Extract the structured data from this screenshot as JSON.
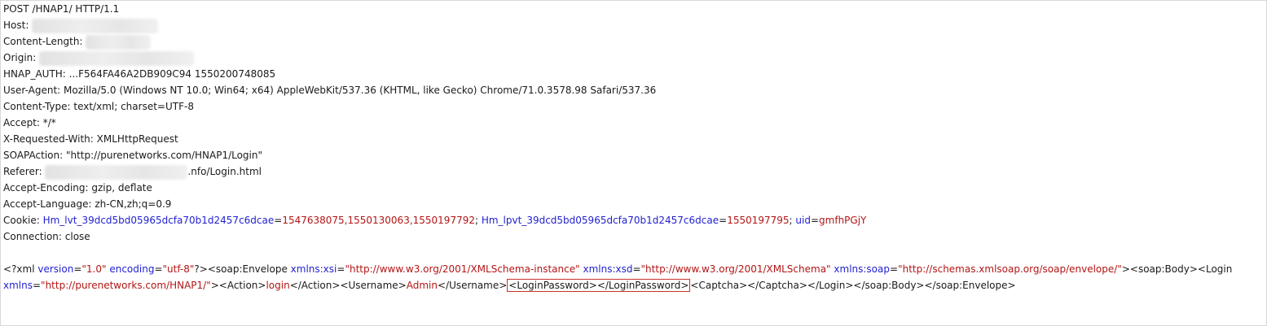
{
  "request_line": "POST /HNAP1/ HTTP/1.1",
  "headers": [
    {
      "key": "Host:",
      "value": ""
    },
    {
      "key": "Content-Length: ",
      "value": ""
    },
    {
      "key": "Origin: ",
      "value": ""
    },
    {
      "key": "HNAP_AUTH: ",
      "value": "...F564FA46A2DB909C94 1550200748085"
    },
    {
      "key": "User-Agent: ",
      "value": "Mozilla/5.0 (Windows NT 10.0; Win64; x64) AppleWebKit/537.36 (KHTML, like Gecko) Chrome/71.0.3578.98 Safari/537.36"
    },
    {
      "key": "Content-Type: ",
      "value": "text/xml; charset=UTF-8"
    },
    {
      "key": "Accept: ",
      "value": "*/*"
    },
    {
      "key": "X-Requested-With: ",
      "value": "XMLHttpRequest"
    },
    {
      "key": "SOAPAction: ",
      "value": "\"http://purenetworks.com/HNAP1/Login\""
    },
    {
      "key": "Referer: ",
      "value": ".nfo/Login.html"
    },
    {
      "key": "Accept-Encoding: ",
      "value": "gzip, deflate"
    },
    {
      "key": "Accept-Language: ",
      "value": "zh-CN,zh;q=0.9"
    }
  ],
  "cookie": {
    "label": "Cookie: ",
    "pairs": [
      {
        "name": "Hm_lvt_39dcd5bd05965dcfa70b1d2457c6dcae",
        "eq": "=",
        "value": "1547638075,1550130063,1550197792",
        "sep": "; "
      },
      {
        "name": "Hm_lpvt_39dcd5bd05965dcfa70b1d2457c6dcae",
        "eq": "=",
        "value": "1550197795",
        "sep": "; "
      },
      {
        "name": "uid",
        "eq": "=",
        "value": "gmfhPGjY",
        "sep": ""
      }
    ]
  },
  "connection": "Connection: close",
  "body": {
    "line1": {
      "decl_open": "<?xml ",
      "attr1_name": "version",
      "attr1_value": "\"1.0\"",
      "attr2_name": "encoding",
      "attr2_value": "\"utf-8\"",
      "decl_close": "?><soap:Envelope ",
      "xsi_name": "xmlns:xsi",
      "xsi_value": "\"http://www.w3.org/2001/XMLSchema-instance\"",
      "xsd_name": "xmlns:xsd",
      "xsd_value": "\"http://www.w3.org/2001/XMLSchema\"",
      "soap_name": "xmlns:soap",
      "soap_value": "\"http://schemas.xmlsoap.org/soap/envelope/\"",
      "tail": "><soap:Body><Login"
    },
    "line2": {
      "xmlns_name": "xmlns",
      "xmlns_value": "\"http://purenetworks.com/HNAP1/\"",
      "action_open": "><Action>",
      "action_value": "login",
      "action_close": "</Action><Username>",
      "username_value": "Admin",
      "username_close": "</Username>",
      "highlighted": "<LoginPassword></LoginPassword>",
      "rest": "<Captcha></Captcha></Login></soap:Body></soap:Envelope>"
    }
  },
  "colors": {
    "param_name": "#1f1fd0",
    "param_value": "#b31515",
    "highlight_border": "#c8322f"
  }
}
